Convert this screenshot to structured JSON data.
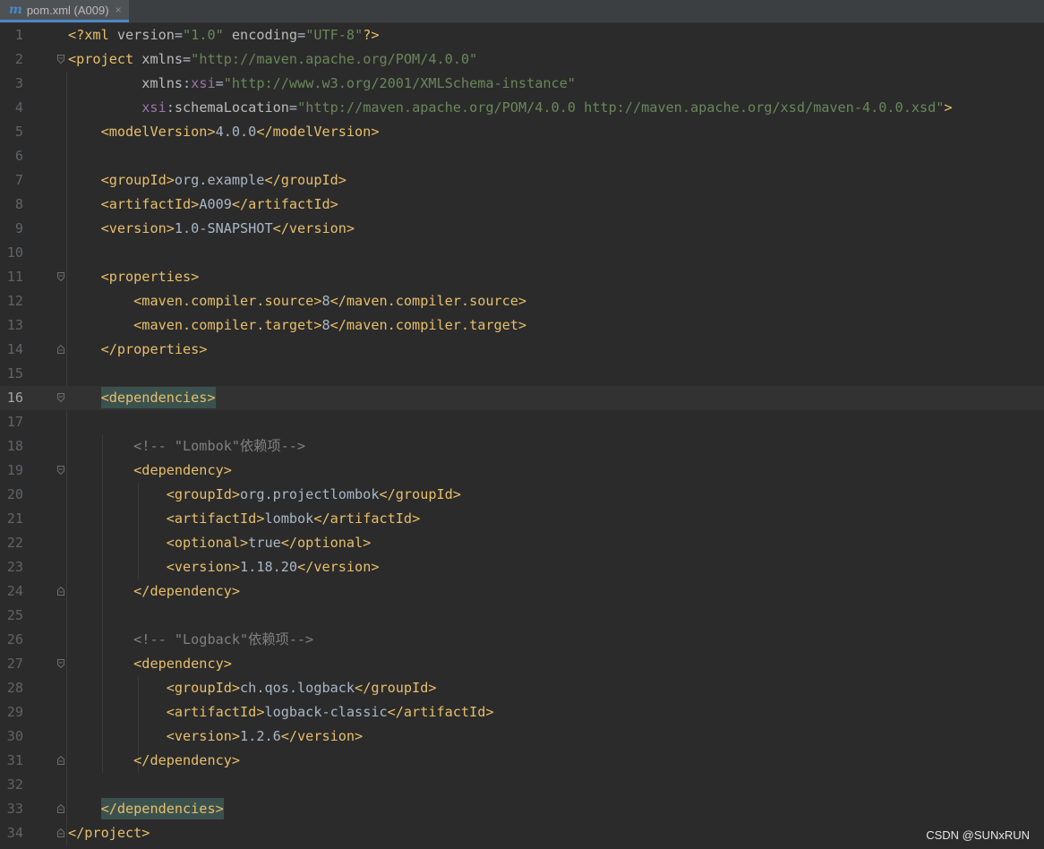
{
  "tab": {
    "icon": "m",
    "title": "pom.xml (A009)",
    "close": "×"
  },
  "watermark": "CSDN @SUNxRUN",
  "lines": [
    {
      "n": "1",
      "tokens": [
        [
          "t",
          "<?xml "
        ],
        [
          "a",
          "version"
        ],
        [
          "x",
          "="
        ],
        [
          "s",
          "\"1.0\""
        ],
        [
          "a",
          " encoding"
        ],
        [
          "x",
          "="
        ],
        [
          "s",
          "\"UTF-8\""
        ],
        [
          "t",
          "?>"
        ]
      ]
    },
    {
      "n": "2",
      "tokens": [
        [
          "t",
          "<project "
        ],
        [
          "a",
          "xmlns"
        ],
        [
          "x",
          "="
        ],
        [
          "s",
          "\"http://maven.apache.org/POM/4.0.0\""
        ]
      ]
    },
    {
      "n": "3",
      "tokens": [
        [
          "a",
          "         xmlns"
        ],
        [
          "x",
          ":"
        ],
        [
          "ns",
          "xsi"
        ],
        [
          "x",
          "="
        ],
        [
          "s",
          "\"http://www.w3.org/2001/XMLSchema-instance\""
        ]
      ]
    },
    {
      "n": "4",
      "tokens": [
        [
          "ns",
          "         xsi"
        ],
        [
          "x",
          ":"
        ],
        [
          "a",
          "schemaLocation"
        ],
        [
          "x",
          "="
        ],
        [
          "s",
          "\"http://maven.apache.org/POM/4.0.0 http://maven.apache.org/xsd/maven-4.0.0.xsd\""
        ],
        [
          "t",
          ">"
        ]
      ]
    },
    {
      "n": "5",
      "tokens": [
        [
          "x",
          "    "
        ],
        [
          "t",
          "<modelVersion>"
        ],
        [
          "x",
          "4.0.0"
        ],
        [
          "t",
          "</modelVersion>"
        ]
      ]
    },
    {
      "n": "6",
      "tokens": []
    },
    {
      "n": "7",
      "tokens": [
        [
          "x",
          "    "
        ],
        [
          "t",
          "<groupId>"
        ],
        [
          "x",
          "org.example"
        ],
        [
          "t",
          "</groupId>"
        ]
      ]
    },
    {
      "n": "8",
      "tokens": [
        [
          "x",
          "    "
        ],
        [
          "t",
          "<artifactId>"
        ],
        [
          "x",
          "A009"
        ],
        [
          "t",
          "</artifactId>"
        ]
      ]
    },
    {
      "n": "9",
      "tokens": [
        [
          "x",
          "    "
        ],
        [
          "t",
          "<version>"
        ],
        [
          "x",
          "1.0-SNAPSHOT"
        ],
        [
          "t",
          "</version>"
        ]
      ]
    },
    {
      "n": "10",
      "tokens": []
    },
    {
      "n": "11",
      "tokens": [
        [
          "x",
          "    "
        ],
        [
          "t",
          "<properties>"
        ]
      ]
    },
    {
      "n": "12",
      "tokens": [
        [
          "x",
          "        "
        ],
        [
          "t",
          "<maven.compiler.source>"
        ],
        [
          "x",
          "8"
        ],
        [
          "t",
          "</maven.compiler.source>"
        ]
      ]
    },
    {
      "n": "13",
      "tokens": [
        [
          "x",
          "        "
        ],
        [
          "t",
          "<maven.compiler.target>"
        ],
        [
          "x",
          "8"
        ],
        [
          "t",
          "</maven.compiler.target>"
        ]
      ]
    },
    {
      "n": "14",
      "tokens": [
        [
          "x",
          "    "
        ],
        [
          "t",
          "</properties>"
        ]
      ]
    },
    {
      "n": "15",
      "tokens": []
    },
    {
      "n": "16",
      "tokens": [
        [
          "x",
          "    "
        ],
        [
          "tm",
          "<dependencies>"
        ]
      ]
    },
    {
      "n": "17",
      "tokens": []
    },
    {
      "n": "18",
      "tokens": [
        [
          "x",
          "        "
        ],
        [
          "c",
          "<!-- \"Lombok\"依赖项-->"
        ]
      ]
    },
    {
      "n": "19",
      "tokens": [
        [
          "x",
          "        "
        ],
        [
          "t",
          "<dependency>"
        ]
      ]
    },
    {
      "n": "20",
      "tokens": [
        [
          "x",
          "            "
        ],
        [
          "t",
          "<groupId>"
        ],
        [
          "x",
          "org.projectlombok"
        ],
        [
          "t",
          "</groupId>"
        ]
      ]
    },
    {
      "n": "21",
      "tokens": [
        [
          "x",
          "            "
        ],
        [
          "t",
          "<artifactId>"
        ],
        [
          "x",
          "lombok"
        ],
        [
          "t",
          "</artifactId>"
        ]
      ]
    },
    {
      "n": "22",
      "tokens": [
        [
          "x",
          "            "
        ],
        [
          "t",
          "<optional>"
        ],
        [
          "x",
          "true"
        ],
        [
          "t",
          "</optional>"
        ]
      ]
    },
    {
      "n": "23",
      "tokens": [
        [
          "x",
          "            "
        ],
        [
          "t",
          "<version>"
        ],
        [
          "x",
          "1.18.20"
        ],
        [
          "t",
          "</version>"
        ]
      ]
    },
    {
      "n": "24",
      "tokens": [
        [
          "x",
          "        "
        ],
        [
          "t",
          "</dependency>"
        ]
      ]
    },
    {
      "n": "25",
      "tokens": []
    },
    {
      "n": "26",
      "tokens": [
        [
          "x",
          "        "
        ],
        [
          "c",
          "<!-- \"Logback\"依赖项-->"
        ]
      ]
    },
    {
      "n": "27",
      "tokens": [
        [
          "x",
          "        "
        ],
        [
          "t",
          "<dependency>"
        ]
      ]
    },
    {
      "n": "28",
      "tokens": [
        [
          "x",
          "            "
        ],
        [
          "t",
          "<groupId>"
        ],
        [
          "x",
          "ch.qos.logback"
        ],
        [
          "t",
          "</groupId>"
        ]
      ]
    },
    {
      "n": "29",
      "tokens": [
        [
          "x",
          "            "
        ],
        [
          "t",
          "<artifactId>"
        ],
        [
          "x",
          "logback-classic"
        ],
        [
          "t",
          "</artifactId>"
        ]
      ]
    },
    {
      "n": "30",
      "tokens": [
        [
          "x",
          "            "
        ],
        [
          "t",
          "<version>"
        ],
        [
          "x",
          "1.2.6"
        ],
        [
          "t",
          "</version>"
        ]
      ]
    },
    {
      "n": "31",
      "tokens": [
        [
          "x",
          "        "
        ],
        [
          "t",
          "</dependency>"
        ]
      ]
    },
    {
      "n": "32",
      "tokens": []
    },
    {
      "n": "33",
      "tokens": [
        [
          "x",
          "    "
        ],
        [
          "tm",
          "</dependencies>"
        ]
      ]
    },
    {
      "n": "34",
      "tokens": [
        [
          "t",
          "</project>"
        ]
      ]
    }
  ]
}
